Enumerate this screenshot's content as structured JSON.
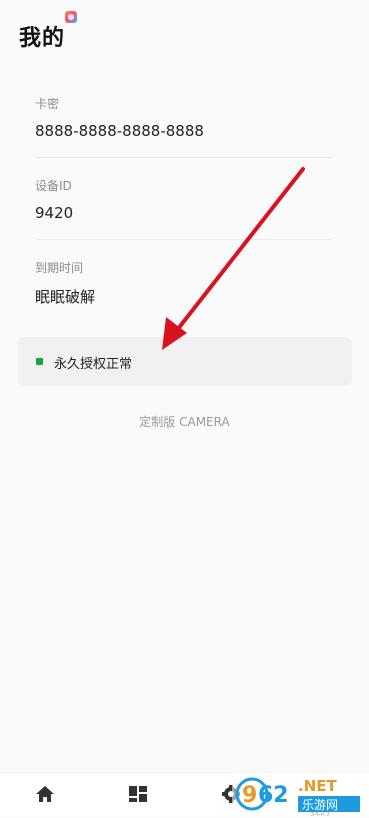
{
  "header": {
    "title": "我的"
  },
  "account": {
    "card_key_label": "卡密",
    "card_key_value": "8888-8888-8888-8888",
    "device_id_label": "设备ID",
    "device_id_value": "9420",
    "expiry_label": "到期时间",
    "expiry_value": "眠眠破解"
  },
  "status": {
    "text": "永久授权正常",
    "color": "#18a53a"
  },
  "footer": {
    "edition": "定制版 CAMERA"
  },
  "nav": {
    "items": [
      {
        "icon": "home-icon"
      },
      {
        "icon": "dashboard-icon"
      },
      {
        "icon": "settings-icon"
      },
      {
        "icon": "profile-icon",
        "label": "我的"
      }
    ]
  },
  "watermark": {
    "text": "962.NET",
    "subtext": "乐游网"
  },
  "colors": {
    "annotation_arrow": "#d9121f"
  }
}
